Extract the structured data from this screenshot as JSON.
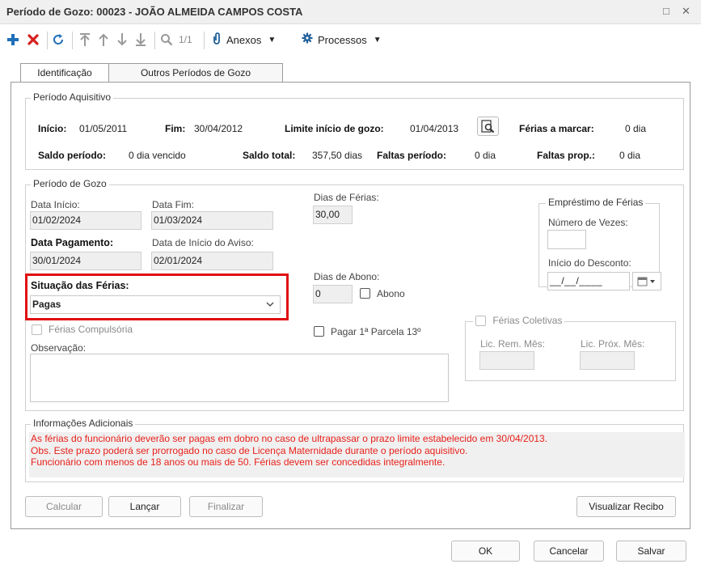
{
  "window": {
    "title": "Período de Gozo: 00023 - JOÃO ALMEIDA CAMPOS COSTA",
    "maximize_glyph": "□",
    "close_glyph": "✕"
  },
  "toolbar": {
    "pagination": "1/1",
    "anexos_label": "Anexos",
    "processos_label": "Processos",
    "icons": [
      "plus-icon",
      "delete-icon",
      "refresh-icon",
      "first-icon",
      "up-icon",
      "down-icon",
      "last-icon",
      "search-icon",
      "attachment-icon",
      "gear-icon",
      "caret-down-icon"
    ]
  },
  "tabs": [
    {
      "label": "Identificação",
      "active": true
    },
    {
      "label": "Outros Períodos de Gozo",
      "active": false
    }
  ],
  "periodo_aquisitivo": {
    "legend": "Período Aquisitivo",
    "inicio_label": "Início:",
    "inicio_value": "01/05/2011",
    "fim_label": "Fim:",
    "fim_value": "30/04/2012",
    "limite_label": "Limite início de gozo:",
    "limite_value": "01/04/2013",
    "ferias_marcar_label": "Férias a marcar:",
    "ferias_marcar_value": "0 dia",
    "saldo_periodo_label": "Saldo período:",
    "saldo_periodo_value": "0 dia vencido",
    "saldo_total_label": "Saldo total:",
    "saldo_total_value": "357,50 dias",
    "faltas_periodo_label": "Faltas período:",
    "faltas_periodo_value": "0 dia",
    "faltas_prop_label": "Faltas prop.:",
    "faltas_prop_value": "0 dia"
  },
  "periodo_gozo": {
    "legend": "Período de Gozo",
    "data_inicio_label": "Data Início:",
    "data_inicio_value": "01/02/2024",
    "data_fim_label": "Data Fim:",
    "data_fim_value": "01/03/2024",
    "dias_ferias_label": "Dias de Férias:",
    "dias_ferias_value": "30,00",
    "data_pagamento_label": "Data Pagamento:",
    "data_pagamento_value": "30/01/2024",
    "data_aviso_label": "Data de Início do Aviso:",
    "data_aviso_value": "02/01/2024",
    "dias_abono_label": "Dias de Abono:",
    "dias_abono_value": "0",
    "abono_label": "Abono",
    "situacao_label": "Situação das Férias:",
    "situacao_value": "Pagas",
    "ferias_compulsoria_label": "Férias Compulsória",
    "pagar_13_label": "Pagar 1ª Parcela 13º",
    "observacao_label": "Observação:",
    "observacao_value": ""
  },
  "emprestimo": {
    "legend": "Empréstimo de Férias",
    "numero_vezes_label": "Número de Vezes:",
    "numero_vezes_value": "",
    "inicio_desconto_label": "Início do Desconto:",
    "inicio_desconto_value": "__/__/____"
  },
  "ferias_coletivas": {
    "label": "Férias Coletivas",
    "lic_rem_label": "Lic. Rem. Mês:",
    "lic_prox_label": "Lic. Próx. Mês:"
  },
  "informacoes": {
    "legend": "Informações Adicionais",
    "lines": [
      "As férias do funcionário deverão ser pagas em dobro no caso de ultrapassar o prazo limite estabelecido em 30/04/2013.",
      "Obs. Este prazo poderá ser prorrogado no caso de Licença Maternidade durante o período aquisitivo.",
      "Funcionário com menos de 18 anos ou mais de 50. Férias devem ser concedidas integralmente."
    ],
    "text_color": "#e8201a"
  },
  "actions": {
    "calcular": "Calcular",
    "lancar": "Lançar",
    "finalizar": "Finalizar",
    "visualizar_recibo": "Visualizar Recibo"
  },
  "footer": {
    "ok": "OK",
    "cancelar": "Cancelar",
    "salvar": "Salvar"
  },
  "colors": {
    "highlight_border": "#e01010",
    "add_icon": "#1f6fb8",
    "delete_icon": "#d62020"
  }
}
